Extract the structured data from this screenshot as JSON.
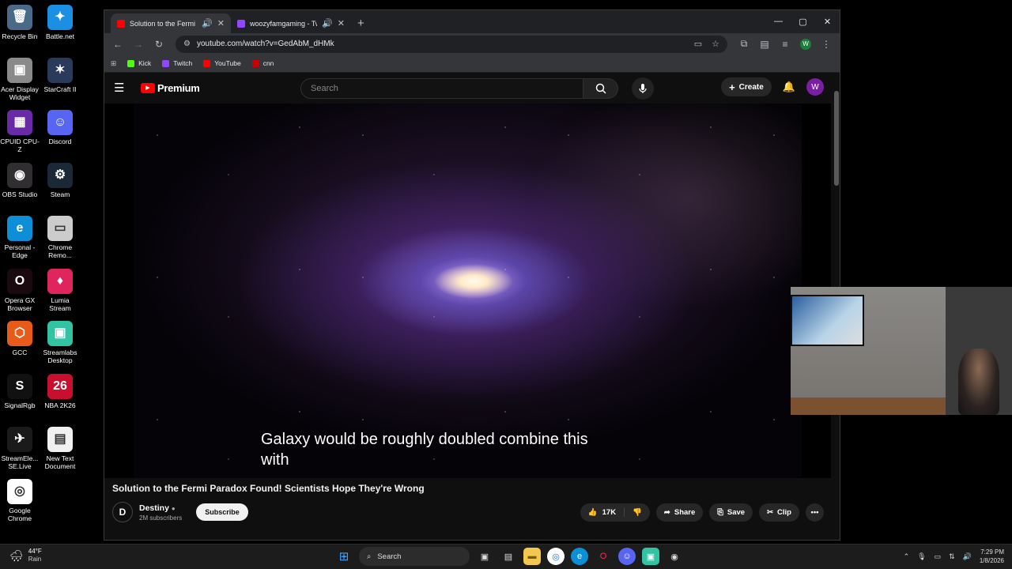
{
  "desktop": {
    "icons": [
      {
        "label": "Recycle Bin",
        "color": "#4a6a8a",
        "glyph": "🗑"
      },
      {
        "label": "Battle.net",
        "color": "#1a8fe3",
        "glyph": "✦"
      },
      {
        "label": "Acer Display Widget",
        "color": "#8a8a8a",
        "glyph": "▣"
      },
      {
        "label": "StarCraft II",
        "color": "#2a3a5a",
        "glyph": "✶"
      },
      {
        "label": "CPUID CPU-Z",
        "color": "#6a2aa8",
        "glyph": "▦"
      },
      {
        "label": "Discord",
        "color": "#5865f2",
        "glyph": "☺"
      },
      {
        "label": "OBS Studio",
        "color": "#302e31",
        "glyph": "◉"
      },
      {
        "label": "Steam",
        "color": "#1b2838",
        "glyph": "⚙"
      },
      {
        "label": "Personal - Edge",
        "color": "#0c8fd6",
        "glyph": "e"
      },
      {
        "label": "Chrome Remo...",
        "color": "#cccccc",
        "glyph": "▭"
      },
      {
        "label": "Opera GX Browser",
        "color": "#1a0a10",
        "glyph": "O"
      },
      {
        "label": "Lumia Stream",
        "color": "#e0245e",
        "glyph": "♦"
      },
      {
        "label": "GCC",
        "color": "#e85a1a",
        "glyph": "⬡"
      },
      {
        "label": "Streamlabs Desktop",
        "color": "#31c3a2",
        "glyph": "▣"
      },
      {
        "label": "SignalRgb",
        "color": "#111111",
        "glyph": "S"
      },
      {
        "label": "NBA 2K26",
        "color": "#c8102e",
        "glyph": "26"
      },
      {
        "label": "StreamEle... SE.Live",
        "color": "#1a1a1a",
        "glyph": "✈"
      },
      {
        "label": "New Text Document",
        "color": "#f0f0f0",
        "glyph": "▤"
      },
      {
        "label": "Google Chrome",
        "color": "#ffffff",
        "glyph": "◎"
      }
    ]
  },
  "browser": {
    "tabs": [
      {
        "title": "Solution to the Fermi Parad",
        "color": "#ff0000"
      },
      {
        "title": "woozyfamgaming - Twitch",
        "color": "#9146ff"
      }
    ],
    "new_tab": "+",
    "url": "youtube.com/watch?v=GedAbM_dHMk",
    "bookmarks": [
      {
        "label": "Kick",
        "color": "#53fc18"
      },
      {
        "label": "Twitch",
        "color": "#9146ff"
      },
      {
        "label": "YouTube",
        "color": "#ff0000"
      },
      {
        "label": "cnn",
        "color": "#cc0000"
      }
    ],
    "profile_initial": "W"
  },
  "youtube": {
    "logo_text": "Premium",
    "search_placeholder": "Search",
    "create_label": "Create",
    "avatar_initial": "W",
    "caption": "Galaxy would be roughly doubled combine this with",
    "video_title": "Solution to the Fermi Paradox Found! Scientists Hope They're Wrong",
    "channel_name": "Destiny",
    "subscribers": "2M subscribers",
    "subscribe_label": "Subscribe",
    "like_count": "17K",
    "share_label": "Share",
    "save_label": "Save",
    "clip_label": "Clip"
  },
  "taskbar": {
    "temperature": "44°F",
    "weather": "Rain",
    "search_label": "Search",
    "time": "7:29 PM",
    "date": "1/8/2026"
  }
}
